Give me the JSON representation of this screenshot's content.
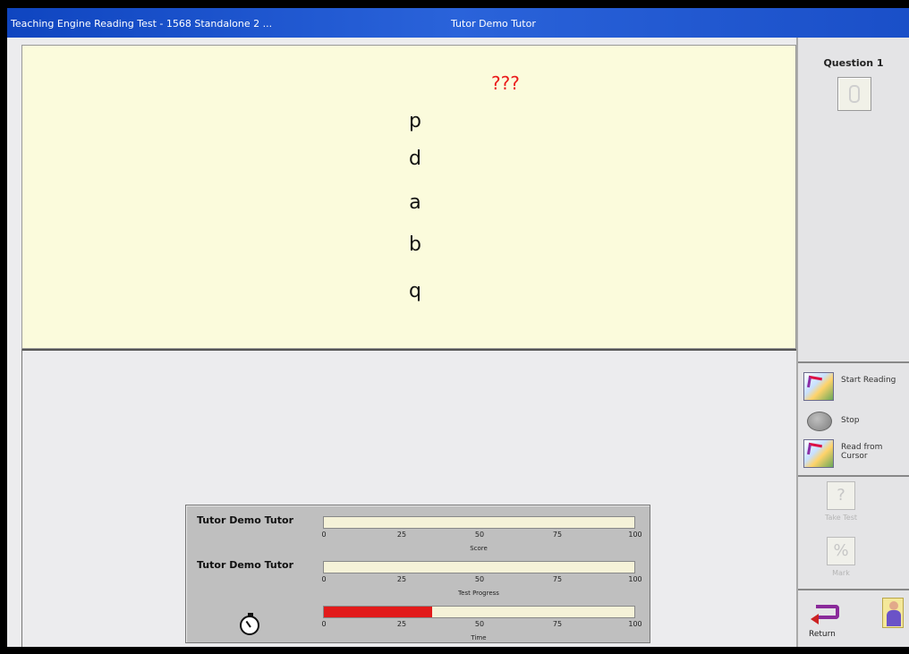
{
  "window": {
    "title_left": "Teaching Engine Reading Test - 1568 Standalone 2 ...",
    "title_center": "Tutor Demo Tutor"
  },
  "question": {
    "prompt": "???",
    "letters": [
      "p",
      "d",
      "a",
      "b",
      "q"
    ]
  },
  "sidebar": {
    "question_label": "Question 1",
    "start_reading": "Start Reading",
    "stop": "Stop",
    "read_from_cursor": "Read from Cursor",
    "take_test": "Take Test",
    "mark": "Mark",
    "return_label": "Return"
  },
  "progress": {
    "bars": [
      {
        "name": "Tutor Demo Tutor",
        "axis_title": "Score",
        "value": 0
      },
      {
        "name": "Tutor Demo Tutor",
        "axis_title": "Test Progress",
        "value": 0
      },
      {
        "name": "",
        "axis_title": "Time",
        "value": 35
      }
    ],
    "ticks": [
      "0",
      "25",
      "50",
      "75",
      "100"
    ],
    "time_fill_color": "#e21a1a"
  },
  "icons": {
    "question_button": "pencil-icon",
    "start_reading": "book-icon",
    "stop": "stop-icon",
    "read_from_cursor": "book-cursor-icon",
    "take_test": "question-icon",
    "mark": "percent-icon",
    "return": "return-arrow-icon",
    "person": "person-icon",
    "stopwatch": "stopwatch-icon"
  }
}
